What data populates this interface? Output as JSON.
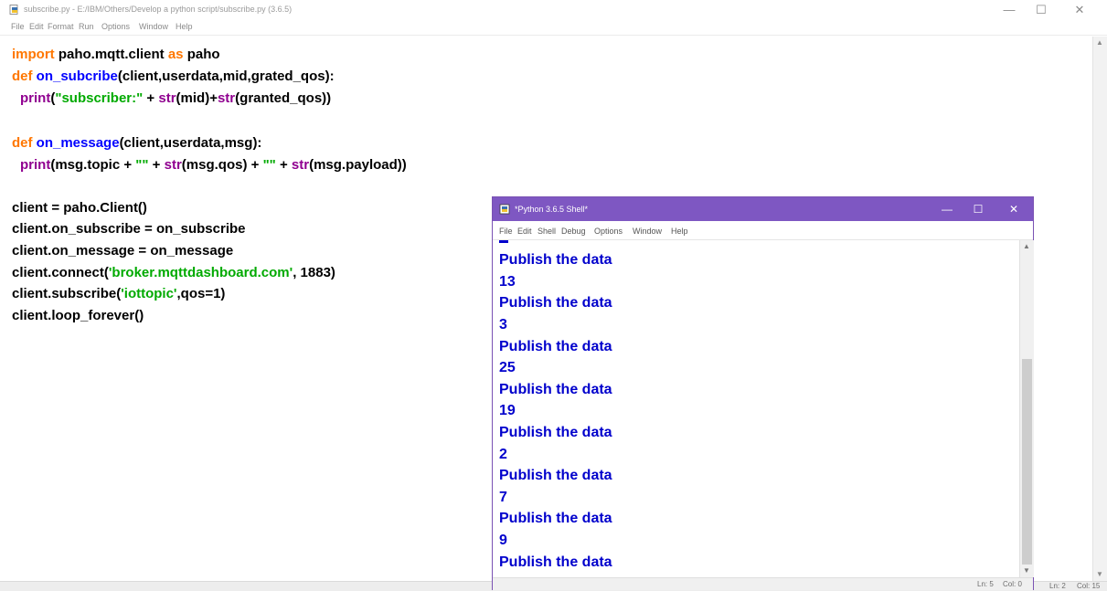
{
  "editor": {
    "title": "subscribe.py - E:/IBM/Others/Develop a python script/subscribe.py (3.6.5)",
    "menu": [
      "File",
      "Edit",
      "Format",
      "Run",
      "Options",
      "Window",
      "Help"
    ],
    "code": {
      "l1": {
        "kw": "import",
        "rest": " paho.mqtt.client ",
        "as": "as",
        "end": " paho"
      },
      "l2": {
        "kw": "def",
        "name": "on_subcribe",
        "rest": "(client,userdata,mid,grated_qos):"
      },
      "l3": {
        "p1": "print",
        "p2": "(",
        "str": "\"subscriber:\"",
        "p3": " + ",
        "b1": "str",
        "p4": "(mid)+",
        "b2": "str",
        "p5": "(granted_qos))"
      },
      "l5": {
        "kw": "def",
        "name": "on_message",
        "rest": "(client,userdata,msg):"
      },
      "l6": {
        "p1": "print",
        "p2": "(msg.topic + ",
        "s1": "\"\"",
        "p3": " + ",
        "b1": "str",
        "p4": "(msg.qos) + ",
        "s2": "\"\"",
        "p5": " + ",
        "b2": "str",
        "p6": "(msg.payload))"
      },
      "l8": "client = paho.Client()",
      "l9": "client.on_subscribe = on_subscribe",
      "l10": "client.on_message = on_message",
      "l11": {
        "p1": "client.connect(",
        "str": "'broker.mqttdashboard.com'",
        "p2": ", 1883)"
      },
      "l12": {
        "p1": "client.subscribe(",
        "str": "'iottopic'",
        "p2": ",qos=1)"
      },
      "l13": "client.loop_forever()"
    },
    "status": {
      "line": "Ln: 2",
      "col": "Col: 15"
    }
  },
  "shell": {
    "title": "*Python 3.6.5 Shell*",
    "menu": [
      "File",
      "Edit",
      "Shell",
      "Debug",
      "Options",
      "Window",
      "Help"
    ],
    "output": [
      "Publish the data",
      "13",
      "Publish the data",
      "3",
      "Publish the data",
      "25",
      "Publish the data",
      "19",
      "Publish the data",
      "2",
      "Publish the data",
      "7",
      "Publish the data",
      "9",
      "Publish the data"
    ],
    "status": {
      "line": "Ln: 5",
      "col": "Col: 0"
    }
  },
  "window_controls": {
    "minimize": "—",
    "maximize": "☐",
    "close": "✕"
  },
  "colors": {
    "keyword": "#ff7700",
    "defname": "#0000ff",
    "builtin": "#900090",
    "string": "#00aa00",
    "output": "#0000cc",
    "shell_titlebar": "#7e57c2"
  }
}
